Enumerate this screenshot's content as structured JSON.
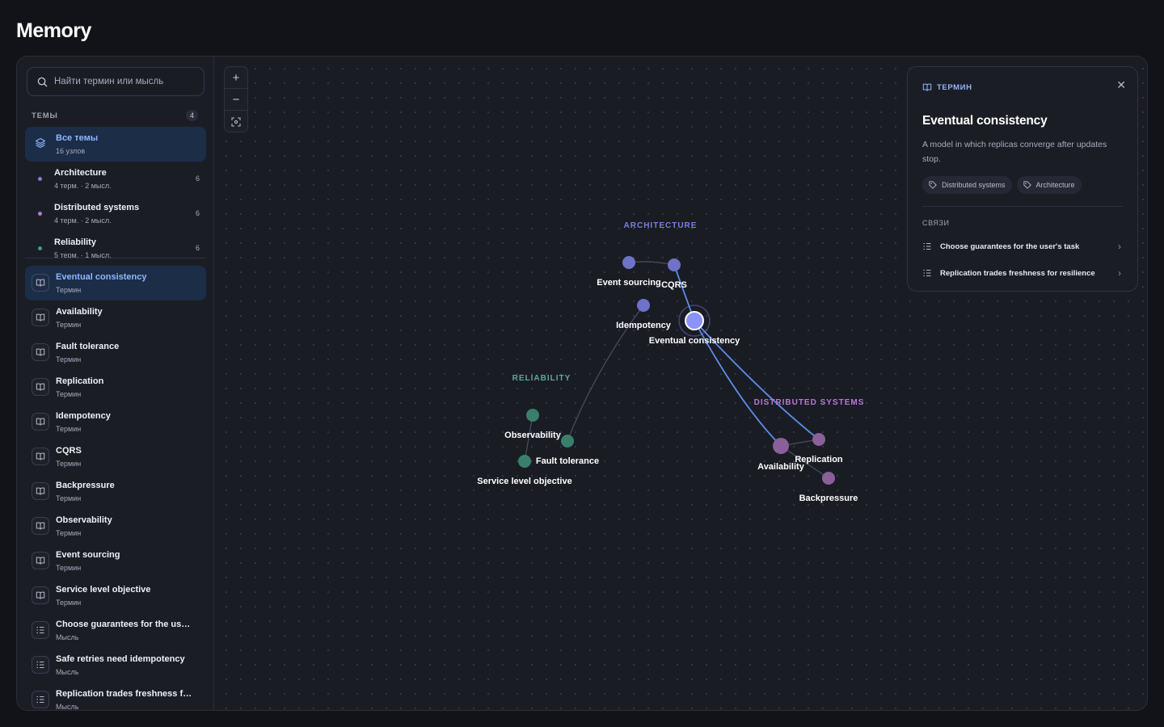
{
  "page": {
    "title": "Memory"
  },
  "search": {
    "placeholder": "Найти термин или мысль"
  },
  "themes": {
    "label": "ТЕМЫ",
    "count": "4",
    "all": {
      "label": "Все темы",
      "sub": "16 узлов"
    },
    "items": [
      {
        "label": "Architecture",
        "sub": "4 терм. · 2 мысл.",
        "count": "6",
        "color": "#7a7fe0"
      },
      {
        "label": "Distributed systems",
        "sub": "4 терм. · 2 мысл.",
        "count": "6",
        "color": "#b67ad0"
      },
      {
        "label": "Reliability",
        "sub": "5 терм. · 1 мысл.",
        "count": "6",
        "color": "#3c9b84"
      }
    ]
  },
  "nodes_list": [
    {
      "label": "Eventual consistency",
      "sub": "Термин",
      "icon": "book-icon"
    },
    {
      "label": "Availability",
      "sub": "Термин",
      "icon": "book-icon"
    },
    {
      "label": "Fault tolerance",
      "sub": "Термин",
      "icon": "book-icon"
    },
    {
      "label": "Replication",
      "sub": "Термин",
      "icon": "book-icon"
    },
    {
      "label": "Idempotency",
      "sub": "Термин",
      "icon": "book-icon"
    },
    {
      "label": "CQRS",
      "sub": "Термин",
      "icon": "book-icon"
    },
    {
      "label": "Backpressure",
      "sub": "Термин",
      "icon": "book-icon"
    },
    {
      "label": "Observability",
      "sub": "Термин",
      "icon": "book-icon"
    },
    {
      "label": "Event sourcing",
      "sub": "Термин",
      "icon": "book-icon"
    },
    {
      "label": "Service level objective",
      "sub": "Термин",
      "icon": "book-icon"
    },
    {
      "label": "Choose guarantees for the user'…",
      "sub": "Мысль",
      "icon": "thought-icon"
    },
    {
      "label": "Safe retries need idempotency",
      "sub": "Мысль",
      "icon": "thought-icon"
    },
    {
      "label": "Replication trades freshness for …",
      "sub": "Мысль",
      "icon": "thought-icon"
    }
  ],
  "zoom": {
    "in": "+",
    "out": "−"
  },
  "graph": {
    "clusters": {
      "architecture": "ARCHITECTURE",
      "reliability": "RELIABILITY",
      "distributed": "DISTRIBUTED SYSTEMS"
    },
    "nodes": {
      "event_sourcing": "Event sourcing",
      "cqrs": "CQRS",
      "idempotency": "Idempotency",
      "eventual": "Eventual consistency",
      "observability": "Observability",
      "fault_tolerance": "Fault tolerance",
      "slo": "Service level objective",
      "availability": "Availability",
      "replication": "Replication",
      "backpressure": "Backpressure"
    },
    "colors": {
      "architecture": "#6f72c8",
      "reliability": "#3a7f6c",
      "distributed": "#8a5f9a",
      "highlight": "#5b8ee8",
      "selected": "#8b93ff"
    }
  },
  "panel": {
    "kicker": "ТЕРМИН",
    "title": "Eventual consistency",
    "description": "A model in which replicas converge after updates stop.",
    "tags": [
      "Distributed systems",
      "Architecture"
    ],
    "links_label": "СВЯЗИ",
    "links": [
      "Choose guarantees for the user's task",
      "Replication trades freshness for resilience"
    ]
  }
}
